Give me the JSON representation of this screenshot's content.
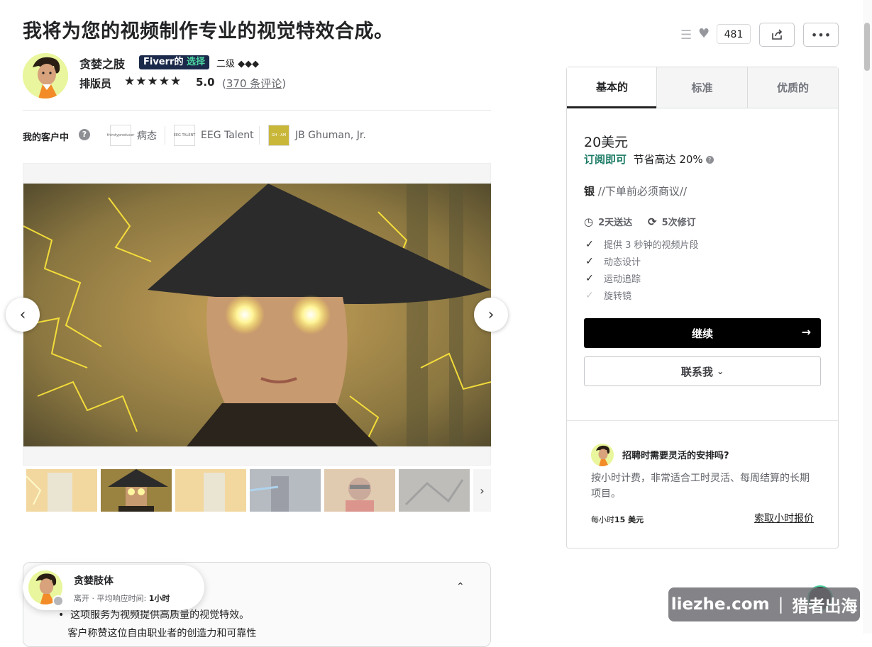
{
  "title": "我将为您的视频制作专业的视觉特效合成。",
  "seller": {
    "name": "贪婪之肢",
    "badge_main": "Fiverr的",
    "badge_choice": "选择",
    "level": "二级 ◆◆◆",
    "role": "排版员",
    "stars": "★★★★★",
    "rating": "5.0",
    "reviews_open": "(",
    "reviews_text": "370 条评论",
    "reviews_close": ")"
  },
  "clients": {
    "label": "我的客户中",
    "items": [
      {
        "logo": "thirstyproducer",
        "name": "病态"
      },
      {
        "logo": "EEG TALENT",
        "name": "EEG Talent"
      },
      {
        "logo": "GH - AM",
        "name": "JB Ghuman, Jr."
      }
    ]
  },
  "actions": {
    "like_count": "481"
  },
  "packages": {
    "tabs": [
      "基本的",
      "标准",
      "优质的"
    ],
    "price": "20美元",
    "subscribe": "订阅即可",
    "save": "节省高达 20%",
    "desc_bold": "银",
    "desc": " //下单前必须商议//",
    "delivery": "2天送达",
    "revisions": "5次修订",
    "features": [
      {
        "label": "提供 3 秒钟的视频片段",
        "included": true
      },
      {
        "label": "动态设计",
        "included": true
      },
      {
        "label": "运动追踪",
        "included": true
      },
      {
        "label": "旋转镜",
        "included": false
      }
    ],
    "continue": "继续",
    "contact": "联系我"
  },
  "hire": {
    "title": "招聘时需要灵活的安排吗?",
    "desc": "按小时计费，非常适合工时灵活、每周结算的长期项目。",
    "hourly_prefix": "每小时",
    "hourly_rate": "15 美元",
    "quote_link": "索取小时报价"
  },
  "about": {
    "line1": "这项服务为视频提供高质量的视觉特效。",
    "line2": "客户称赞这位自由职业者的创造力和可靠性"
  },
  "chat": {
    "name": "贪婪肢体",
    "status": "离开",
    "response_label": "平均响应时间:",
    "response_value": "1小时"
  },
  "watermark": {
    "left": "liezhe.com",
    "sep": "|",
    "right": "猎者出海"
  },
  "colors": {
    "accent_green": "#1a7a64",
    "primary_button": "#000000",
    "badge_bg": "#1b2a4a"
  }
}
